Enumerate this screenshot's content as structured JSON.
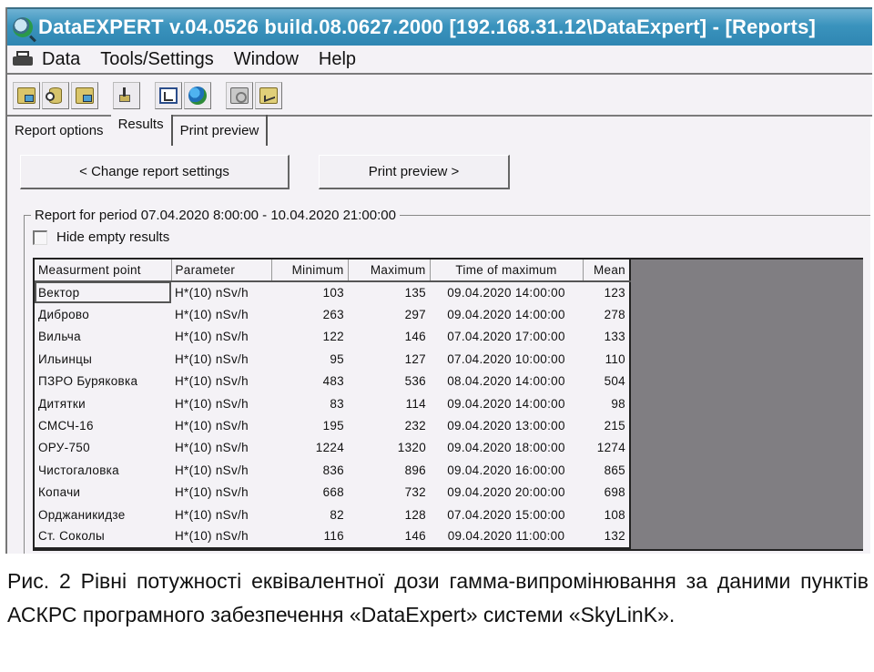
{
  "window": {
    "title": "DataEXPERT v.04.0526 build.08.0627.2000 [192.168.31.12\\DataExpert] - [Reports]"
  },
  "menubar": {
    "items": [
      {
        "label": "Data"
      },
      {
        "label": "Tools/Settings"
      },
      {
        "label": "Window"
      },
      {
        "label": "Help"
      }
    ]
  },
  "toolbar": {
    "buttons": [
      {
        "icon": "open-archive-icon"
      },
      {
        "icon": "import-database-icon"
      },
      {
        "icon": "copy-archive-icon"
      },
      {
        "icon": "export-icon"
      },
      {
        "icon": "tree-view-icon"
      },
      {
        "icon": "globe-icon"
      },
      {
        "icon": "settings-folder-icon"
      },
      {
        "icon": "chart-folder-icon"
      }
    ]
  },
  "tabs": [
    {
      "label": "Report options",
      "active": false
    },
    {
      "label": "Results",
      "active": true
    },
    {
      "label": "Print preview",
      "active": false
    }
  ],
  "actions": {
    "change_settings": "< Change report settings",
    "print_preview": "Print preview >"
  },
  "report": {
    "period_label": "Report for period 07.04.2020 8:00:00 - 10.04.2020 21:00:00",
    "hide_empty_label": "Hide empty results",
    "hide_empty_checked": false,
    "columns": [
      "Measurment point",
      "Parameter",
      "Minimum",
      "Maximum",
      "Time of maximum",
      "Mean"
    ],
    "rows": [
      {
        "point": "Вектор",
        "parameter": "H*(10) nSv/h",
        "min": "103",
        "max": "135",
        "time": "09.04.2020 14:00:00",
        "mean": "123"
      },
      {
        "point": "Диброво",
        "parameter": "H*(10) nSv/h",
        "min": "263",
        "max": "297",
        "time": "09.04.2020 14:00:00",
        "mean": "278"
      },
      {
        "point": "Вильча",
        "parameter": "H*(10) nSv/h",
        "min": "122",
        "max": "146",
        "time": "07.04.2020 17:00:00",
        "mean": "133"
      },
      {
        "point": "Ильинцы",
        "parameter": "H*(10) nSv/h",
        "min": "95",
        "max": "127",
        "time": "07.04.2020 10:00:00",
        "mean": "110"
      },
      {
        "point": "ПЗРО Буряковка",
        "parameter": "H*(10) nSv/h",
        "min": "483",
        "max": "536",
        "time": "08.04.2020 14:00:00",
        "mean": "504"
      },
      {
        "point": "Дитятки",
        "parameter": "H*(10) nSv/h",
        "min": "83",
        "max": "114",
        "time": "09.04.2020 14:00:00",
        "mean": "98"
      },
      {
        "point": "СМСЧ-16",
        "parameter": "H*(10) nSv/h",
        "min": "195",
        "max": "232",
        "time": "09.04.2020 13:00:00",
        "mean": "215"
      },
      {
        "point": "ОРУ-750",
        "parameter": "H*(10) nSv/h",
        "min": "1224",
        "max": "1320",
        "time": "09.04.2020 18:00:00",
        "mean": "1274"
      },
      {
        "point": "Чистогаловка",
        "parameter": "H*(10) nSv/h",
        "min": "836",
        "max": "896",
        "time": "09.04.2020 16:00:00",
        "mean": "865"
      },
      {
        "point": "Копачи",
        "parameter": "H*(10) nSv/h",
        "min": "668",
        "max": "732",
        "time": "09.04.2020 20:00:00",
        "mean": "698"
      },
      {
        "point": "Орджаникидзе",
        "parameter": "H*(10) nSv/h",
        "min": "82",
        "max": "128",
        "time": "07.04.2020 15:00:00",
        "mean": "108"
      },
      {
        "point": "Ст. Соколы",
        "parameter": "H*(10) nSv/h",
        "min": "116",
        "max": "146",
        "time": "09.04.2020 11:00:00",
        "mean": "132"
      }
    ]
  },
  "caption": {
    "text": "Рис. 2 Рівні потужності еквівалентної дози гамма-випромінювання за даними пунктів АСКРС програмного забезпечення «DataExpert» системи «SkyLinK»."
  },
  "colors": {
    "titlebar": "#3a93bd",
    "window_bg": "#f4f2f6",
    "grid_empty": "#807e82"
  }
}
